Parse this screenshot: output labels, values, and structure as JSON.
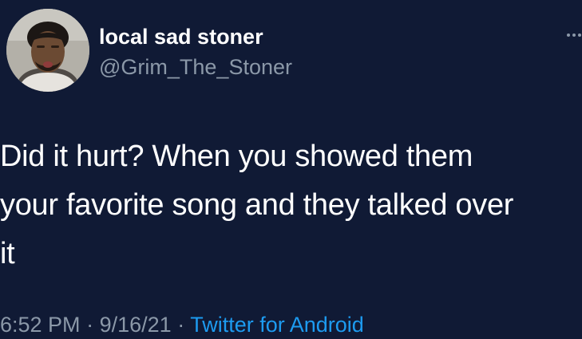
{
  "tweet": {
    "author": {
      "display_name": "local sad stoner",
      "handle": "@Grim_The_Stoner"
    },
    "text": "Did it hurt? When you showed them\nyour favorite song and they talked over\nit",
    "time": "6:52 PM",
    "separator": "·",
    "date": "9/16/21",
    "source": "Twitter for Android"
  },
  "colors": {
    "background": "#101a35",
    "text": "#ffffff",
    "secondary_text": "#8b98a8",
    "link": "#1d9bf0"
  },
  "icons": {
    "more": "more-horizontal-icon"
  }
}
